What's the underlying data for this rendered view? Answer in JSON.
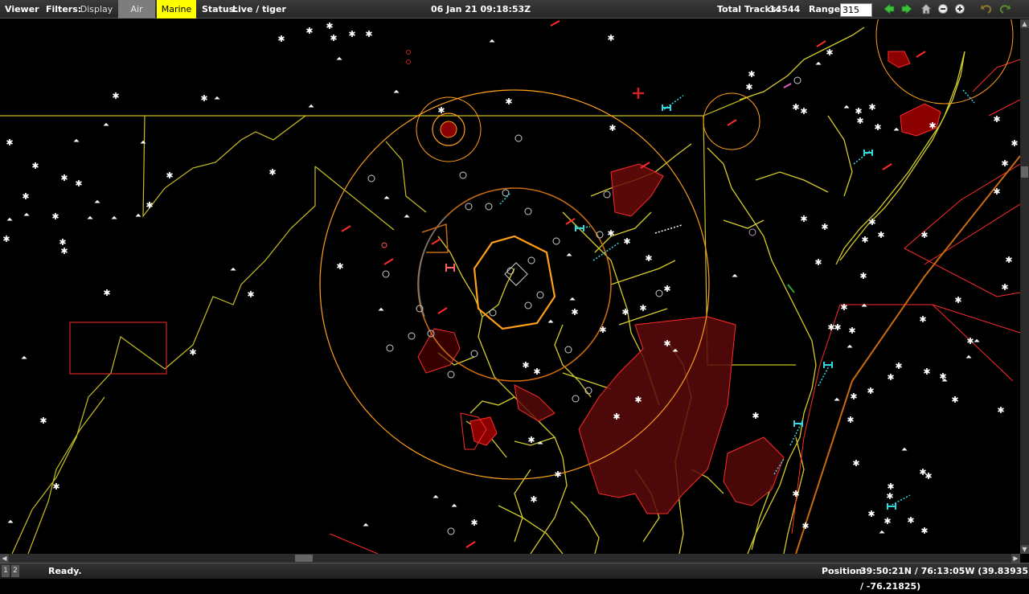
{
  "toolbar": {
    "viewer_label": "Viewer",
    "filters_label": "Filters:",
    "filter_buttons": {
      "display": "Display",
      "air": "Air",
      "marine": "Marine"
    },
    "status_label": "Status:",
    "status_value": "Live / tiger",
    "datetime": "06 Jan 21 09:18:53Z",
    "total_tracks_label": "Total Tracks:",
    "total_tracks_value": "14544",
    "range_label": "Range:",
    "range_value": "315"
  },
  "icons": {
    "back": "back-arrow-icon",
    "forward": "forward-arrow-icon",
    "home": "home-icon",
    "zoom_out": "zoom-out-icon",
    "zoom_in": "zoom-in-icon",
    "undo": "undo-icon",
    "redo": "redo-icon"
  },
  "colors": {
    "toolbar_bg": "#2e2e2e",
    "air_filter": "#7d7d7d",
    "marine_filter": "#ffff00",
    "map_bg": "#000000",
    "coastline": "#d4cc2a",
    "state_border": "#c8c020",
    "range_ring": "#ff9f1a",
    "restricted_area": "#8b0000",
    "aircraft": "#ffffff",
    "hostile": "#ff2a2a",
    "friendly_marine": "#34d6e0"
  },
  "statusbar": {
    "pages": [
      "1",
      "2"
    ],
    "message": "Ready.",
    "position_label": "Position:",
    "position_value": "39:50:21N / 76:13:05W  (39.83935 / -76.21825)"
  }
}
